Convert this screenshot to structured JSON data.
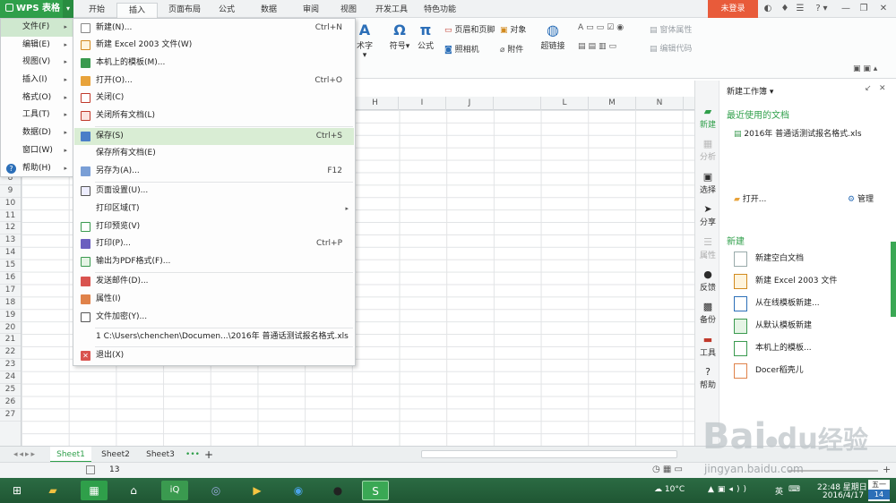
{
  "app": {
    "logo_label": "WPS 表格",
    "tabs": [
      "开始",
      "插入",
      "页面布局",
      "公式",
      "数据",
      "审阅",
      "视图",
      "开发工具",
      "特色功能"
    ],
    "active_tab": "插入",
    "login_label": "未登录"
  },
  "ribbon": {
    "art_text": "术字",
    "symbol": "符号",
    "formula": "公式",
    "header_footer": "页眉和页脚",
    "camera": "照相机",
    "object": "对象",
    "attachment": "附件",
    "hyperlink": "超链接",
    "window_props": "窗体属性",
    "edit_code": "编辑代码"
  },
  "columns": [
    "H",
    "I",
    "J",
    "L",
    "M",
    "N"
  ],
  "rows": [
    7,
    8,
    9,
    10,
    11,
    12,
    13,
    14,
    15,
    16,
    17,
    18,
    19,
    20,
    21,
    22,
    23,
    24,
    25,
    26,
    27
  ],
  "main_menu": [
    {
      "label": "文件(F)",
      "sub": true,
      "selected": true
    },
    {
      "label": "编辑(E)",
      "sub": true
    },
    {
      "label": "视图(V)",
      "sub": true
    },
    {
      "label": "插入(I)",
      "sub": true
    },
    {
      "label": "格式(O)",
      "sub": true
    },
    {
      "label": "工具(T)",
      "sub": true
    },
    {
      "label": "数据(D)",
      "sub": true
    },
    {
      "label": "窗口(W)",
      "sub": true
    },
    {
      "label": "帮助(H)",
      "sub": true
    }
  ],
  "file_menu": {
    "new": {
      "label": "新建(N)...",
      "shortcut": "Ctrl+N"
    },
    "new_excel": {
      "label": "新建 Excel 2003 文件(W)"
    },
    "local_template": {
      "label": "本机上的模板(M)..."
    },
    "open": {
      "label": "打开(O)...",
      "shortcut": "Ctrl+O"
    },
    "close": {
      "label": "关闭(C)"
    },
    "close_all": {
      "label": "关闭所有文档(L)"
    },
    "save": {
      "label": "保存(S)",
      "shortcut": "Ctrl+S"
    },
    "save_all": {
      "label": "保存所有文档(E)"
    },
    "save_as": {
      "label": "另存为(A)...",
      "shortcut": "F12"
    },
    "page_setup": {
      "label": "页面设置(U)..."
    },
    "print_area": {
      "label": "打印区域(T)"
    },
    "print_preview": {
      "label": "打印预览(V)"
    },
    "print": {
      "label": "打印(P)...",
      "shortcut": "Ctrl+P"
    },
    "export_pdf": {
      "label": "输出为PDF格式(F)..."
    },
    "send_mail": {
      "label": "发送邮件(D)..."
    },
    "properties": {
      "label": "属性(I)"
    },
    "encrypt": {
      "label": "文件加密(Y)..."
    },
    "recent_1": {
      "label": "1 C:\\Users\\chenchen\\Documen...\\2016年 普通话测试报名格式.xls"
    },
    "exit": {
      "label": "退出(X)"
    }
  },
  "side_strip": {
    "new": "新建",
    "analyze": "分析",
    "select": "选择",
    "share": "分享",
    "props": "属性",
    "feedback": "反馈",
    "backup": "备份",
    "tools": "工具",
    "help": "帮助"
  },
  "pane": {
    "title": "新建工作簿",
    "recent_heading": "最近使用的文档",
    "recent_file": "2016年 普通话测试报名格式.xls",
    "open_label": "打开...",
    "manage_label": "管理",
    "new_heading": "新建",
    "items": [
      "新建空白文档",
      "新建 Excel 2003 文件",
      "从在线模板新建...",
      "从默认模板新建",
      "本机上的模板...",
      "Docer稻壳儿"
    ]
  },
  "sheets": [
    "Sheet1",
    "Sheet2",
    "Sheet3"
  ],
  "status": {
    "cell_count": "13"
  },
  "taskbar": {
    "temperature": "10°C",
    "ime": "英",
    "time": "22:48 星期日",
    "date": "2016/4/17",
    "cal_weekday": "五一",
    "cal_day": "14"
  },
  "watermark": {
    "brand": "Bai",
    "brand_cn": "经验",
    "url": "jingyan.baidu.com"
  },
  "colors": {
    "accent": "#2f9f4a",
    "login": "#e85b3a",
    "taskbar": "#2b6b43"
  }
}
